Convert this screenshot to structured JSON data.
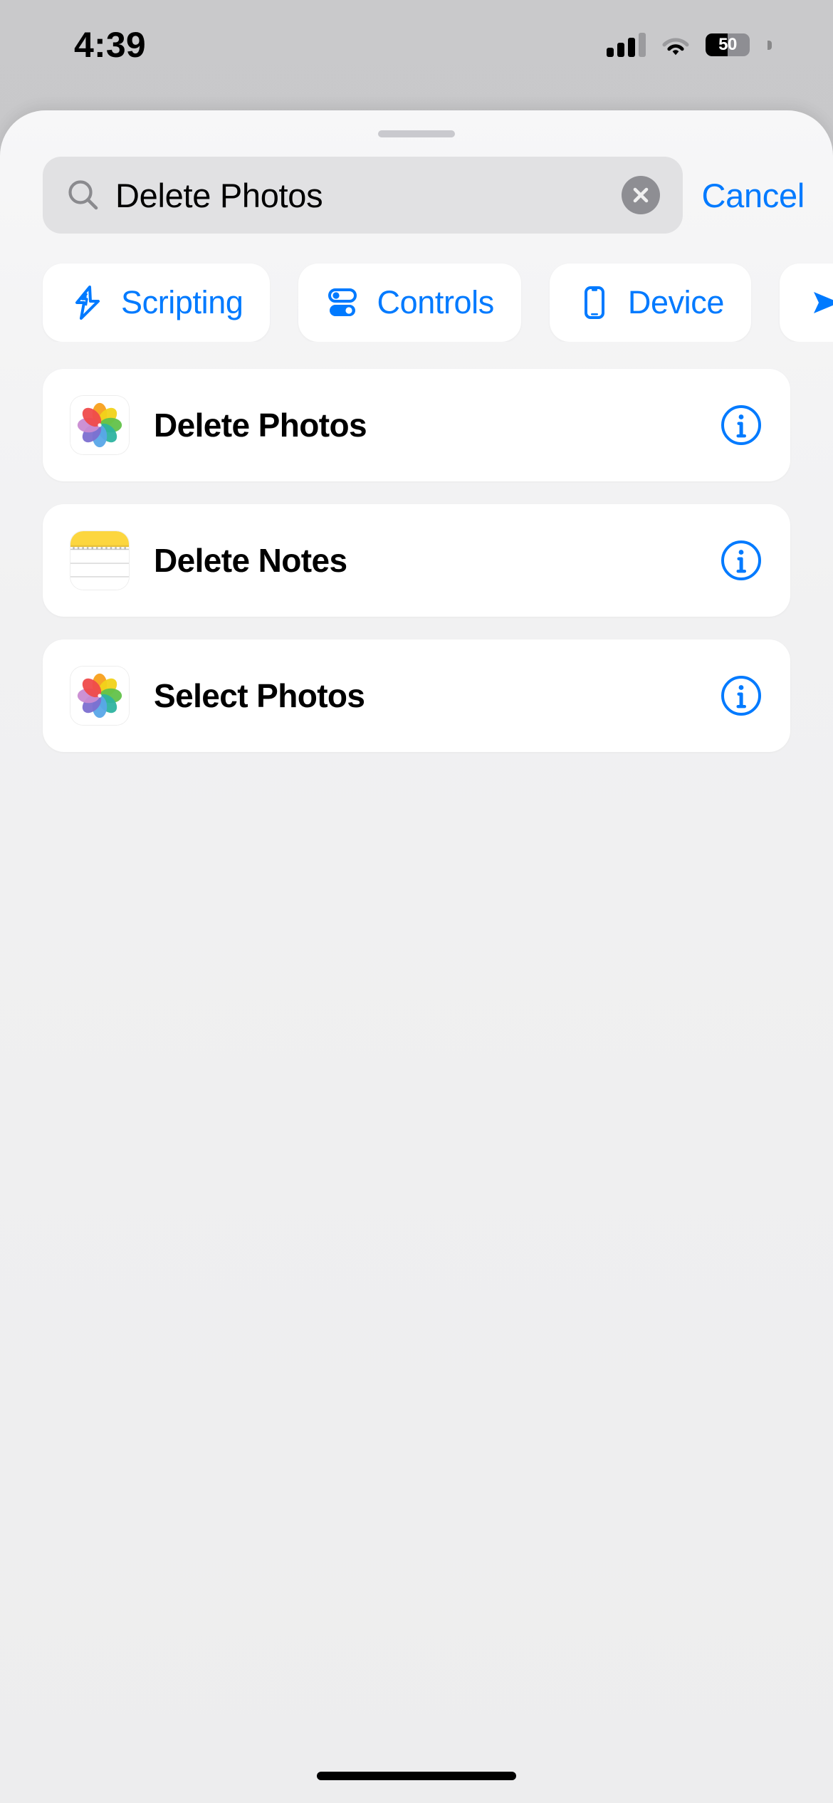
{
  "status_bar": {
    "time": "4:39",
    "cellular_icon": "cellular-bars-icon",
    "wifi_icon": "wifi-icon",
    "battery_percent": "50",
    "battery_level": 50
  },
  "sheet": {
    "grabber": "sheet-grabber"
  },
  "search": {
    "icon": "search-icon",
    "value": "Delete Photos",
    "placeholder": "Search",
    "clear_icon": "clear-circle-icon",
    "cancel_label": "Cancel"
  },
  "filters": {
    "chips": [
      {
        "label": "Scripting",
        "icon": "scripting-icon",
        "selected": false
      },
      {
        "label": "Controls",
        "icon": "controls-toggles-icon",
        "selected": false
      },
      {
        "label": "Device",
        "icon": "device-phone-icon",
        "selected": false
      },
      {
        "label": "",
        "icon": "sharing-arrow-icon",
        "selected": false
      }
    ]
  },
  "results": {
    "items": [
      {
        "title": "Delete Photos",
        "app_icon": "photos-app-icon",
        "info_icon": "info-circle-icon"
      },
      {
        "title": "Delete Notes",
        "app_icon": "notes-app-icon",
        "info_icon": "info-circle-icon"
      },
      {
        "title": "Select Photos",
        "app_icon": "photos-app-icon",
        "info_icon": "info-circle-icon"
      }
    ]
  },
  "colors": {
    "accent_blue": "#007aff",
    "sheet_bg": "#f2f2f3",
    "card_bg": "#ffffff",
    "search_field_bg": "#e1e1e3",
    "backdrop": "#c9c9cb"
  },
  "home_indicator": "home-indicator"
}
